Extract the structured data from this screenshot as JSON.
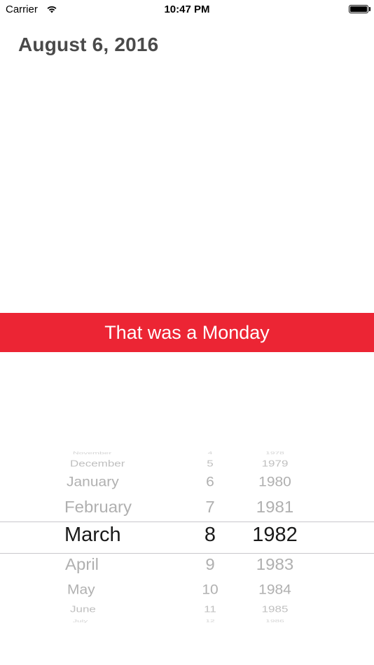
{
  "status_bar": {
    "carrier": "Carrier",
    "time": "10:47 PM",
    "icons": [
      "wifi-icon",
      "battery-icon"
    ]
  },
  "date_title": "August 6, 2016",
  "result_banner": {
    "text": "That was a Monday",
    "color": "#ec2534"
  },
  "picker": {
    "months": [
      "November",
      "December",
      "January",
      "February",
      "March",
      "April",
      "May",
      "June",
      "July"
    ],
    "days": [
      "4",
      "5",
      "6",
      "7",
      "8",
      "9",
      "10",
      "11",
      "12"
    ],
    "years": [
      "1978",
      "1979",
      "1980",
      "1981",
      "1982",
      "1983",
      "1984",
      "1985",
      "1986"
    ],
    "selected": {
      "month": "March",
      "day": "8",
      "year": "1982"
    }
  }
}
